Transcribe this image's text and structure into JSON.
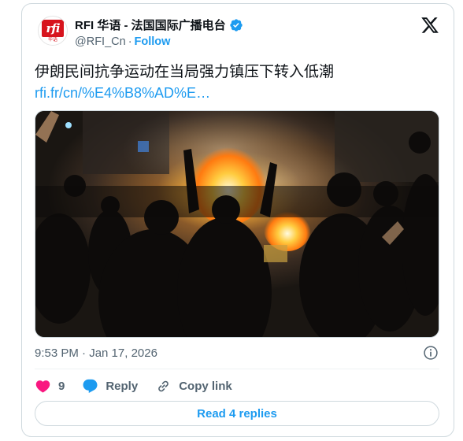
{
  "header": {
    "display_name": "RFI 华语 - 法国国际广播电台",
    "handle": "@RFI_Cn",
    "separator": "·",
    "follow_label": "Follow",
    "logo_text": "rfi",
    "logo_sub": "华语"
  },
  "tweet": {
    "text": "伊朗民间抗争运动在当局强力镇压下转入低潮",
    "link": "rfi.fr/cn/%E4%B8%AD%E…"
  },
  "meta": {
    "timestamp": "9:53 PM · Jan 17, 2026"
  },
  "actions": {
    "likes_count": "9",
    "reply_label": "Reply",
    "copy_link_label": "Copy link"
  },
  "read_replies_label": "Read 4 replies",
  "colors": {
    "accent": "#1d9bf0",
    "like": "#f91880",
    "text_secondary": "#536471",
    "border": "#cfd9de"
  },
  "icons": {
    "brand": "x-logo-icon",
    "verified": "verified-badge-icon",
    "info": "info-icon",
    "like": "heart-icon",
    "reply": "chat-bubble-icon",
    "copy": "link-icon"
  }
}
